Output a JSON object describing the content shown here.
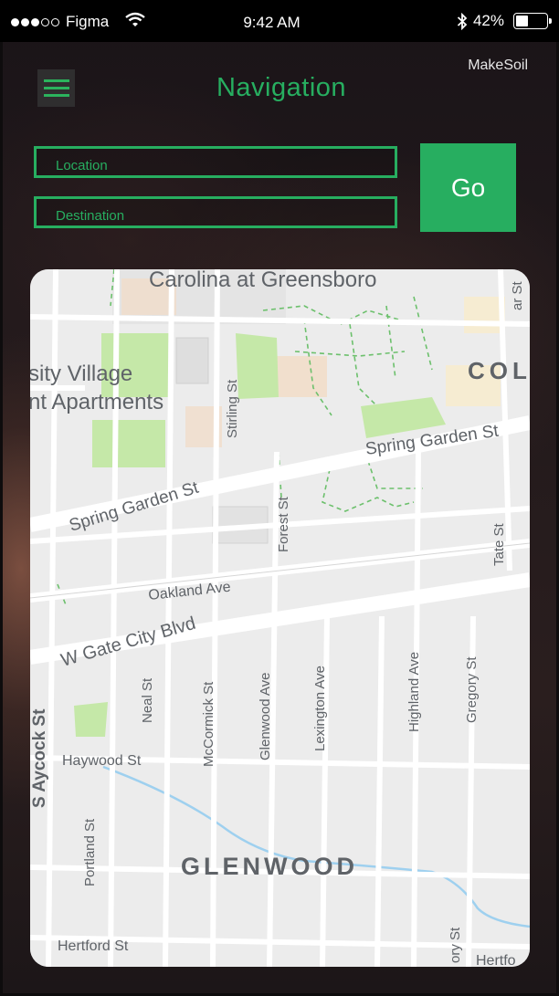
{
  "status_bar": {
    "carrier": "Figma",
    "time": "9:42 AM",
    "battery_percent": "42%",
    "battery_level": 0.42,
    "signal_bars_filled": 3,
    "signal_bars_total": 5
  },
  "header": {
    "brand": "MakeSoil",
    "title": "Navigation",
    "menu_icon": "hamburger-menu-icon"
  },
  "form": {
    "location_placeholder": "Location",
    "destination_placeholder": "Destination",
    "go_label": "Go"
  },
  "map": {
    "labels": {
      "campus": "Carolina at Greensboro",
      "village_line1": "sity Village",
      "village_line2": "nt Apartments",
      "col": "COL",
      "spring_garden_1": "Spring Garden St",
      "spring_garden_2": "Spring Garden St",
      "stirling": "Stirling St",
      "forest": "Forest St",
      "tate": "Tate St",
      "oakland": "Oakland Ave",
      "gate_city": "W Gate City Blvd",
      "neal": "Neal St",
      "mccormick": "McCormick St",
      "glenwood_ave": "Glenwood Ave",
      "lexington": "Lexington Ave",
      "highland": "Highland Ave",
      "gregory": "Gregory St",
      "aycock": "S Aycock St",
      "haywood": "Haywood St",
      "portland": "Portland St",
      "glenwood": "GLENWOOD",
      "hertford_1": "Hertford St",
      "hertford_2": "Hertfo",
      "ory": "ory St",
      "ar_st": "ar St"
    }
  },
  "colors": {
    "accent": "#27ae60",
    "statusbar_bg": "#000000",
    "map_bg": "#ececec",
    "park": "#c5e8a8",
    "water": "#9ed0ef"
  }
}
